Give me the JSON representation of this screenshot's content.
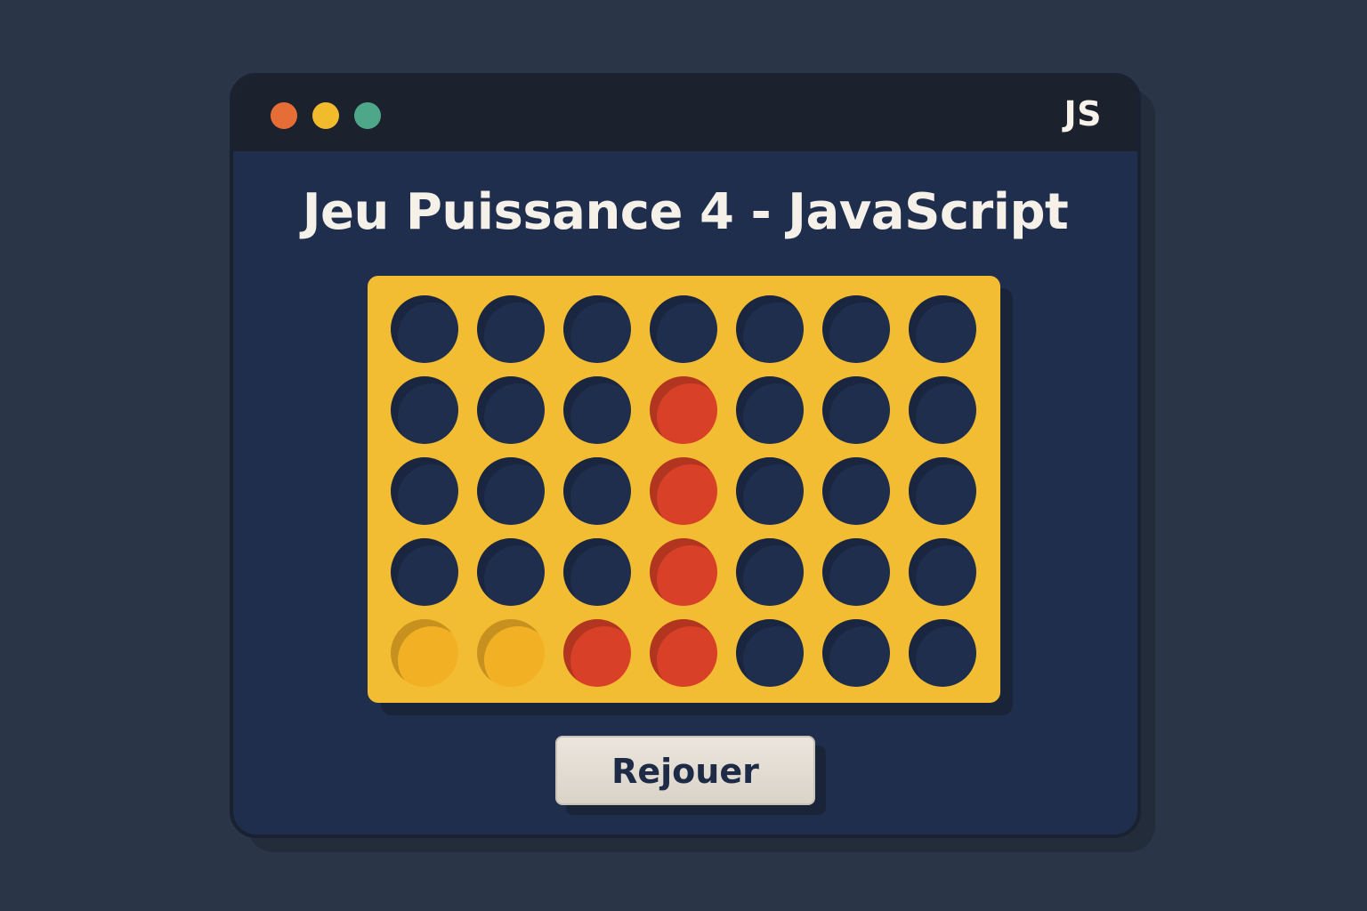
{
  "window": {
    "badge": "JS",
    "controls": {
      "close_color": "#e66d35",
      "minimize_color": "#f1bb2c",
      "maximize_color": "#4ea789"
    }
  },
  "game": {
    "title": "Jeu Puissance 4 - JavaScript",
    "board": {
      "rows": 5,
      "columns": 7,
      "cells": [
        [
          "empty",
          "empty",
          "empty",
          "empty",
          "empty",
          "empty",
          "empty"
        ],
        [
          "empty",
          "empty",
          "empty",
          "red",
          "empty",
          "empty",
          "empty"
        ],
        [
          "empty",
          "empty",
          "empty",
          "red",
          "empty",
          "empty",
          "empty"
        ],
        [
          "empty",
          "empty",
          "empty",
          "red",
          "empty",
          "empty",
          "empty"
        ],
        [
          "yellow",
          "yellow",
          "red",
          "red",
          "empty",
          "empty",
          "empty"
        ]
      ]
    },
    "colors": {
      "board": "#f3bd33",
      "empty": "#1f2e4d",
      "red": "#d84127",
      "yellow": "#f2b125"
    }
  },
  "actions": {
    "replay_label": "Rejouer"
  }
}
